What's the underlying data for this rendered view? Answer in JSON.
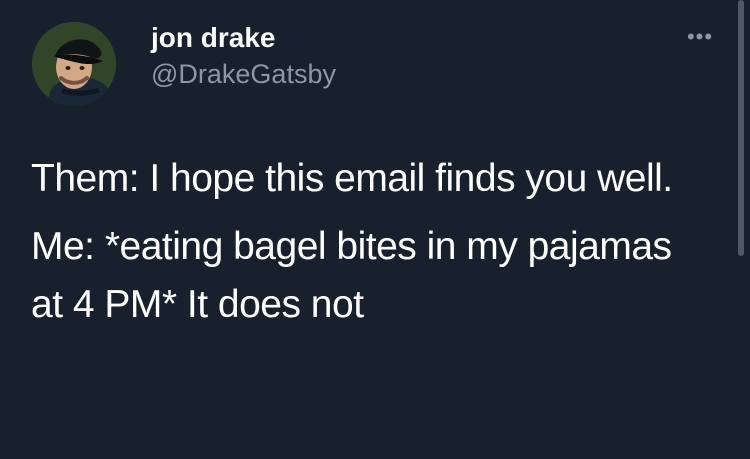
{
  "tweet": {
    "author": {
      "display_name": "jon drake",
      "handle": "@DrakeGatsby",
      "avatar_icon": "profile-photo"
    },
    "more_icon": "more-options-icon",
    "more_label": "•••",
    "text_lines": [
      "Them: I hope this email finds you well.",
      "Me: *eating bagel bites in my pajamas at 4 PM* It does not"
    ]
  },
  "theme": {
    "background": "#17202c",
    "text": "#ffffff",
    "secondary_text": "#8a98a5",
    "scrollbar": "#4f5964"
  }
}
